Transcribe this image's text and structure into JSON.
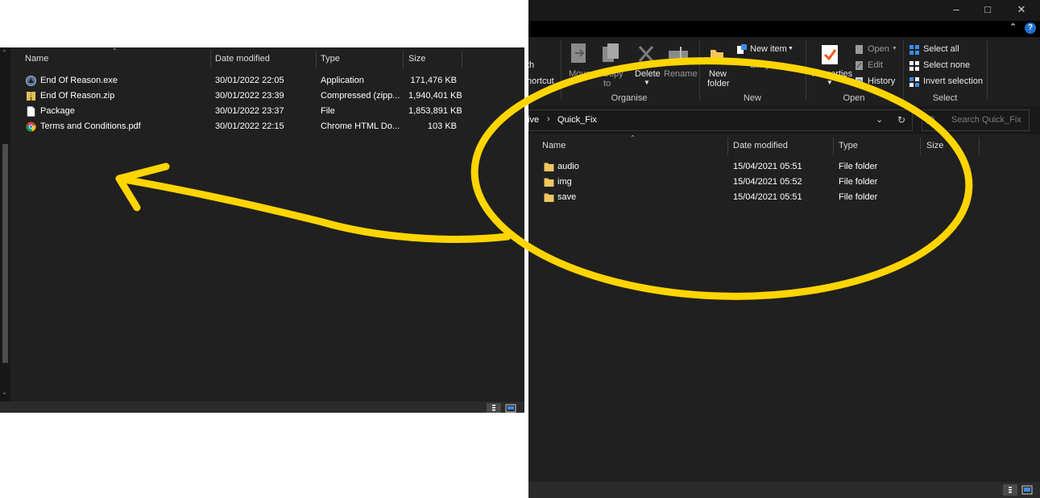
{
  "left_window": {
    "columns": {
      "name": "Name",
      "date": "Date modified",
      "type": "Type",
      "size": "Size"
    },
    "files": [
      {
        "name": "End Of Reason.exe",
        "date": "30/01/2022 22:05",
        "type": "Application",
        "size": "171,476 KB",
        "icon": "exe-icon"
      },
      {
        "name": "End Of Reason.zip",
        "date": "30/01/2022 23:39",
        "type": "Compressed (zipp...",
        "size": "1,940,401 KB",
        "icon": "zip-icon"
      },
      {
        "name": "Package",
        "date": "30/01/2022 23:37",
        "type": "File",
        "size": "1,853,891 KB",
        "icon": "file-icon"
      },
      {
        "name": "Terms and Conditions.pdf",
        "date": "30/01/2022 22:15",
        "type": "Chrome HTML Do...",
        "size": "103 KB",
        "icon": "chrome-icon"
      }
    ]
  },
  "right_window": {
    "ribbon": {
      "partial_path_label": "th",
      "partial_shortcut_label": "hortcut",
      "move_label": "Move",
      "copy_label": "Copy",
      "to_label": "to",
      "delete_label": "Delete",
      "rename_label": "Rename",
      "new_folder_label_1": "New",
      "new_folder_label_2": "folder",
      "new_item_label": "New item",
      "easy_access_label": "Easy",
      "properties_label": "Properties",
      "open_label": "Open",
      "edit_label": "Edit",
      "history_label": "History",
      "select_all_label": "Select all",
      "select_none_label": "Select none",
      "invert_selection_label": "Invert selection",
      "groups": {
        "organise": "Organise",
        "new": "New",
        "open": "Open",
        "select": "Select"
      }
    },
    "address": {
      "prev_segment": "ive",
      "current": "Quick_Fix"
    },
    "search": {
      "placeholder": "Search Quick_Fix"
    },
    "columns": {
      "name": "Name",
      "date": "Date modified",
      "type": "Type",
      "size": "Size"
    },
    "folders": [
      {
        "name": "audio",
        "date": "15/04/2021 05:51",
        "type": "File folder"
      },
      {
        "name": "img",
        "date": "15/04/2021 05:52",
        "type": "File folder"
      },
      {
        "name": "save",
        "date": "15/04/2021 05:51",
        "type": "File folder"
      }
    ]
  },
  "annotation_color": "#FFD500"
}
